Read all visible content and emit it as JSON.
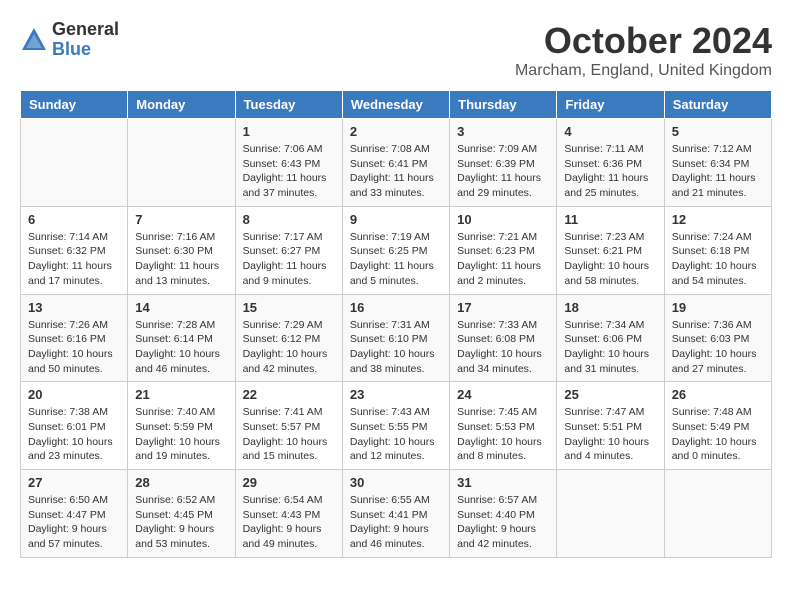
{
  "header": {
    "logo_general": "General",
    "logo_blue": "Blue",
    "month_year": "October 2024",
    "location": "Marcham, England, United Kingdom"
  },
  "days_of_week": [
    "Sunday",
    "Monday",
    "Tuesday",
    "Wednesday",
    "Thursday",
    "Friday",
    "Saturday"
  ],
  "weeks": [
    [
      {
        "day": "",
        "detail": ""
      },
      {
        "day": "",
        "detail": ""
      },
      {
        "day": "1",
        "detail": "Sunrise: 7:06 AM\nSunset: 6:43 PM\nDaylight: 11 hours and 37 minutes."
      },
      {
        "day": "2",
        "detail": "Sunrise: 7:08 AM\nSunset: 6:41 PM\nDaylight: 11 hours and 33 minutes."
      },
      {
        "day": "3",
        "detail": "Sunrise: 7:09 AM\nSunset: 6:39 PM\nDaylight: 11 hours and 29 minutes."
      },
      {
        "day": "4",
        "detail": "Sunrise: 7:11 AM\nSunset: 6:36 PM\nDaylight: 11 hours and 25 minutes."
      },
      {
        "day": "5",
        "detail": "Sunrise: 7:12 AM\nSunset: 6:34 PM\nDaylight: 11 hours and 21 minutes."
      }
    ],
    [
      {
        "day": "6",
        "detail": "Sunrise: 7:14 AM\nSunset: 6:32 PM\nDaylight: 11 hours and 17 minutes."
      },
      {
        "day": "7",
        "detail": "Sunrise: 7:16 AM\nSunset: 6:30 PM\nDaylight: 11 hours and 13 minutes."
      },
      {
        "day": "8",
        "detail": "Sunrise: 7:17 AM\nSunset: 6:27 PM\nDaylight: 11 hours and 9 minutes."
      },
      {
        "day": "9",
        "detail": "Sunrise: 7:19 AM\nSunset: 6:25 PM\nDaylight: 11 hours and 5 minutes."
      },
      {
        "day": "10",
        "detail": "Sunrise: 7:21 AM\nSunset: 6:23 PM\nDaylight: 11 hours and 2 minutes."
      },
      {
        "day": "11",
        "detail": "Sunrise: 7:23 AM\nSunset: 6:21 PM\nDaylight: 10 hours and 58 minutes."
      },
      {
        "day": "12",
        "detail": "Sunrise: 7:24 AM\nSunset: 6:18 PM\nDaylight: 10 hours and 54 minutes."
      }
    ],
    [
      {
        "day": "13",
        "detail": "Sunrise: 7:26 AM\nSunset: 6:16 PM\nDaylight: 10 hours and 50 minutes."
      },
      {
        "day": "14",
        "detail": "Sunrise: 7:28 AM\nSunset: 6:14 PM\nDaylight: 10 hours and 46 minutes."
      },
      {
        "day": "15",
        "detail": "Sunrise: 7:29 AM\nSunset: 6:12 PM\nDaylight: 10 hours and 42 minutes."
      },
      {
        "day": "16",
        "detail": "Sunrise: 7:31 AM\nSunset: 6:10 PM\nDaylight: 10 hours and 38 minutes."
      },
      {
        "day": "17",
        "detail": "Sunrise: 7:33 AM\nSunset: 6:08 PM\nDaylight: 10 hours and 34 minutes."
      },
      {
        "day": "18",
        "detail": "Sunrise: 7:34 AM\nSunset: 6:06 PM\nDaylight: 10 hours and 31 minutes."
      },
      {
        "day": "19",
        "detail": "Sunrise: 7:36 AM\nSunset: 6:03 PM\nDaylight: 10 hours and 27 minutes."
      }
    ],
    [
      {
        "day": "20",
        "detail": "Sunrise: 7:38 AM\nSunset: 6:01 PM\nDaylight: 10 hours and 23 minutes."
      },
      {
        "day": "21",
        "detail": "Sunrise: 7:40 AM\nSunset: 5:59 PM\nDaylight: 10 hours and 19 minutes."
      },
      {
        "day": "22",
        "detail": "Sunrise: 7:41 AM\nSunset: 5:57 PM\nDaylight: 10 hours and 15 minutes."
      },
      {
        "day": "23",
        "detail": "Sunrise: 7:43 AM\nSunset: 5:55 PM\nDaylight: 10 hours and 12 minutes."
      },
      {
        "day": "24",
        "detail": "Sunrise: 7:45 AM\nSunset: 5:53 PM\nDaylight: 10 hours and 8 minutes."
      },
      {
        "day": "25",
        "detail": "Sunrise: 7:47 AM\nSunset: 5:51 PM\nDaylight: 10 hours and 4 minutes."
      },
      {
        "day": "26",
        "detail": "Sunrise: 7:48 AM\nSunset: 5:49 PM\nDaylight: 10 hours and 0 minutes."
      }
    ],
    [
      {
        "day": "27",
        "detail": "Sunrise: 6:50 AM\nSunset: 4:47 PM\nDaylight: 9 hours and 57 minutes."
      },
      {
        "day": "28",
        "detail": "Sunrise: 6:52 AM\nSunset: 4:45 PM\nDaylight: 9 hours and 53 minutes."
      },
      {
        "day": "29",
        "detail": "Sunrise: 6:54 AM\nSunset: 4:43 PM\nDaylight: 9 hours and 49 minutes."
      },
      {
        "day": "30",
        "detail": "Sunrise: 6:55 AM\nSunset: 4:41 PM\nDaylight: 9 hours and 46 minutes."
      },
      {
        "day": "31",
        "detail": "Sunrise: 6:57 AM\nSunset: 4:40 PM\nDaylight: 9 hours and 42 minutes."
      },
      {
        "day": "",
        "detail": ""
      },
      {
        "day": "",
        "detail": ""
      }
    ]
  ]
}
